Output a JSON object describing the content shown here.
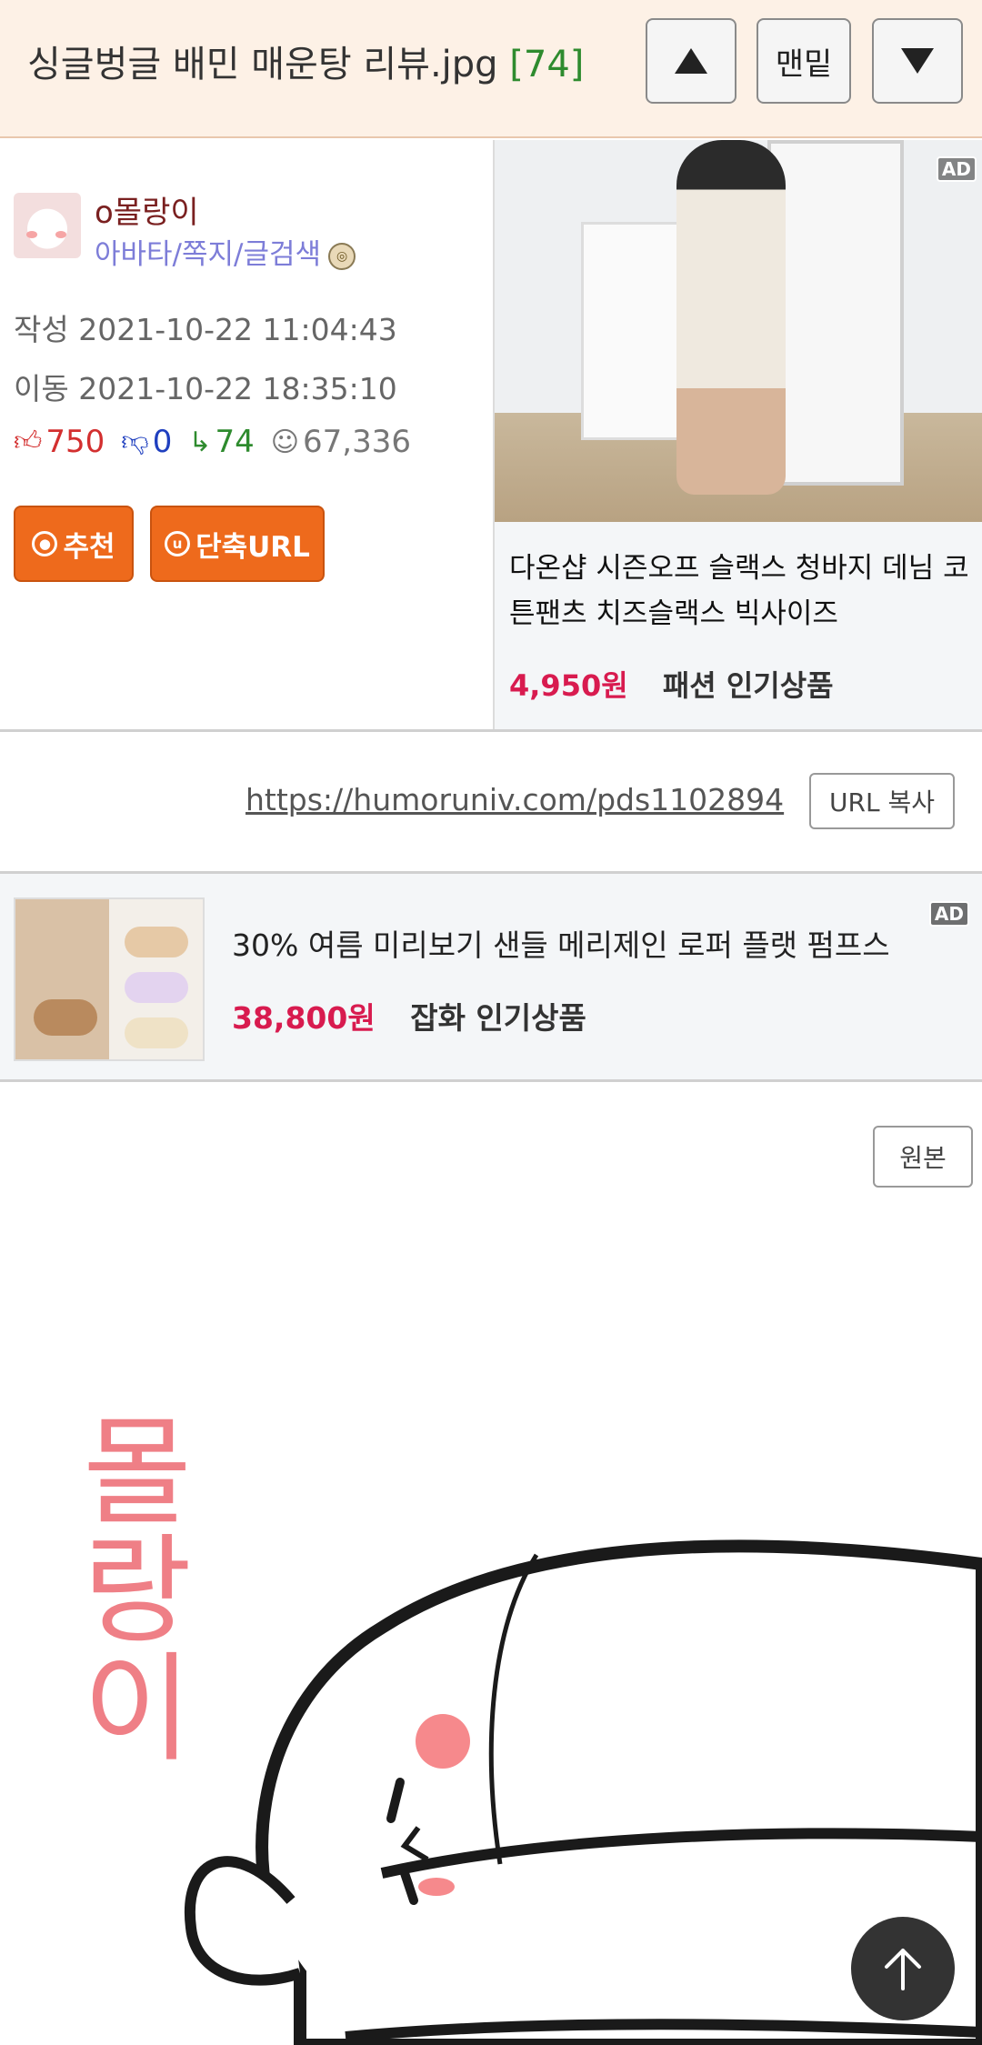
{
  "header": {
    "title": "싱글벙글 배민 매운탕 리뷰.jpg",
    "comment_count": "[74]",
    "bottom_label": "맨밑"
  },
  "author": {
    "nickname": "o몰랑이",
    "links": "아바타/쪽지/글검색",
    "written": "작성 2021-10-22 11:04:43",
    "moved": "이동 2021-10-22 18:35:10",
    "upvotes": "750",
    "downvotes": "0",
    "replies": "74",
    "views": "67,336",
    "recommend_label": "추천",
    "short_url_label": "단축URL"
  },
  "ad1": {
    "tag": "AD",
    "name": "다온샵 시즌오프 슬랙스 청바지 데님 코튼팬츠 치즈슬랙스 빅사이즈",
    "price": "4,950원",
    "category": "패션 인기상품"
  },
  "url_row": {
    "url": "https://humoruniv.com/pds1102894",
    "copy_label": "URL 복사"
  },
  "ad2": {
    "tag": "AD",
    "name": "30% 여름 미리보기 샌들 메리제인 로퍼 플랫 펌프스",
    "price": "38,800원",
    "category": "잡화 인기상품"
  },
  "post": {
    "original_label": "원본",
    "image_text": "몰랑이"
  },
  "colors": {
    "header_bg": "#fdf1e6",
    "accent_orange": "#ee6a1c",
    "price_red": "#d81b4f",
    "link_purple": "#7d7dd8"
  }
}
